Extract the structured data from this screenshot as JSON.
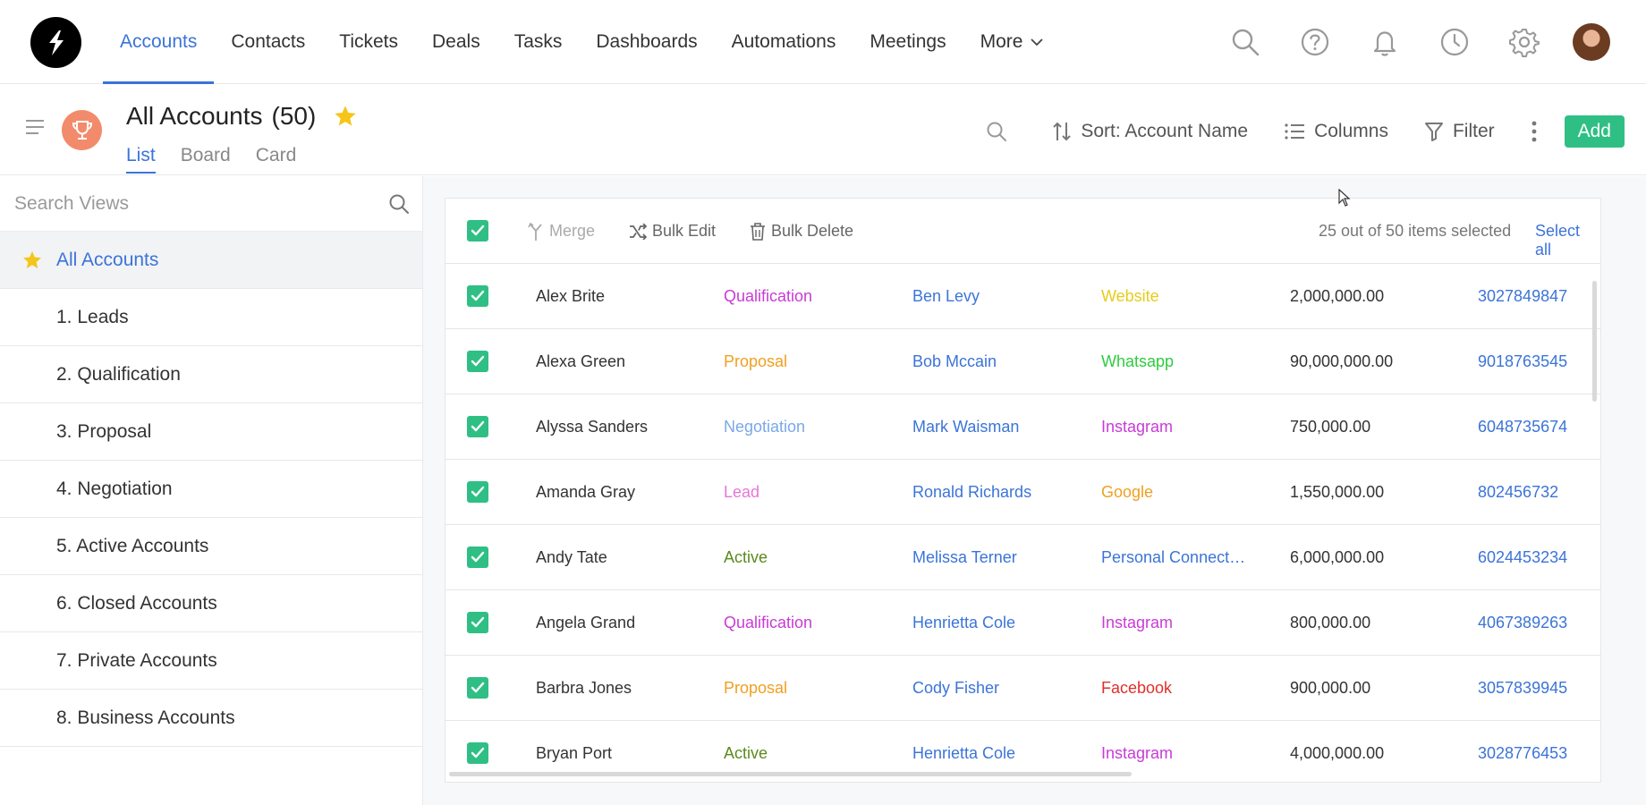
{
  "nav": {
    "items": [
      {
        "label": "Accounts",
        "active": true
      },
      {
        "label": "Contacts"
      },
      {
        "label": "Tickets"
      },
      {
        "label": "Deals"
      },
      {
        "label": "Tasks"
      },
      {
        "label": "Dashboards"
      },
      {
        "label": "Automations"
      },
      {
        "label": "Meetings"
      }
    ],
    "more_label": "More",
    "icons": [
      "search-icon",
      "help-icon",
      "bell-icon",
      "clock-icon",
      "gear-icon"
    ]
  },
  "header": {
    "title": "All Accounts",
    "count": "(50)",
    "tabs": [
      "List",
      "Board",
      "Card"
    ],
    "active_tab": "List",
    "sort_label": "Sort: Account Name",
    "columns_label": "Columns",
    "filter_label": "Filter",
    "add_label": "Add"
  },
  "sidebar": {
    "search_placeholder": "Search Views",
    "views": [
      {
        "label": "All Accounts",
        "active": true
      },
      {
        "label": "1. Leads"
      },
      {
        "label": "2. Qualification"
      },
      {
        "label": "3. Proposal"
      },
      {
        "label": "4. Negotiation"
      },
      {
        "label": "5. Active Accounts"
      },
      {
        "label": "6. Closed Accounts"
      },
      {
        "label": "7. Private Accounts"
      },
      {
        "label": "8. Business Accounts"
      }
    ]
  },
  "bulkbar": {
    "merge_label": "Merge",
    "bulk_edit_label": "Bulk Edit",
    "bulk_delete_label": "Bulk Delete",
    "selected_text": "25 out of 50 items selected",
    "select_all_label": "Select all"
  },
  "stage_colors": {
    "Qualification": "#c93ad6",
    "Proposal": "#f0a020",
    "Negotiation": "#7aa8e8",
    "Lead": "#e876d8",
    "Active": "#5a8a1e"
  },
  "source_colors": {
    "Website": "#e6cc1a",
    "Whatsapp": "#2ecc40",
    "Instagram": "#c93ad6",
    "Google": "#f0a020",
    "Personal Connect…": "#3b74d8",
    "Facebook": "#e0302a"
  },
  "rows": [
    {
      "name": "Alex Brite",
      "stage": "Qualification",
      "owner": "Ben Levy",
      "source": "Website",
      "amount": "2,000,000.00",
      "phone": "3027849847"
    },
    {
      "name": "Alexa Green",
      "stage": "Proposal",
      "owner": "Bob Mccain",
      "source": "Whatsapp",
      "amount": "90,000,000.00",
      "phone": "9018763545"
    },
    {
      "name": "Alyssa Sanders",
      "stage": "Negotiation",
      "owner": "Mark Waisman",
      "source": "Instagram",
      "amount": "750,000.00",
      "phone": "6048735674"
    },
    {
      "name": "Amanda Gray",
      "stage": "Lead",
      "owner": "Ronald Richards",
      "source": "Google",
      "amount": "1,550,000.00",
      "phone": "802456732"
    },
    {
      "name": "Andy Tate",
      "stage": "Active",
      "owner": "Melissa Terner",
      "source": "Personal Connect…",
      "amount": "6,000,000.00",
      "phone": "6024453234"
    },
    {
      "name": "Angela Grand",
      "stage": "Qualification",
      "owner": "Henrietta Cole",
      "source": "Instagram",
      "amount": "800,000.00",
      "phone": "4067389263"
    },
    {
      "name": "Barbra Jones",
      "stage": "Proposal",
      "owner": "Cody Fisher",
      "source": "Facebook",
      "amount": "900,000.00",
      "phone": "3057839945"
    },
    {
      "name": "Bryan Port",
      "stage": "Active",
      "owner": "Henrietta Cole",
      "source": "Instagram",
      "amount": "4,000,000.00",
      "phone": "3028776453"
    }
  ]
}
